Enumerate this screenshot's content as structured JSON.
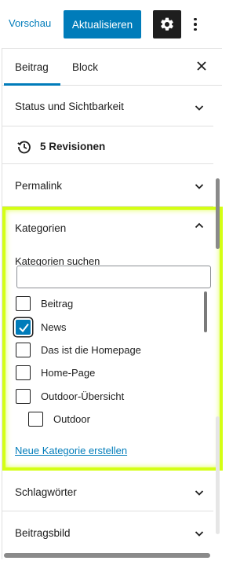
{
  "toolbar": {
    "preview_label": "Vorschau",
    "update_label": "Aktualisieren",
    "settings_icon": "gear-icon",
    "more_icon": "more-vertical-icon"
  },
  "tabs": {
    "post": "Beitrag",
    "block": "Block"
  },
  "panels": {
    "status": "Status und Sichtbarkeit",
    "revisions": "5 Revisionen",
    "permalink": "Permalink",
    "categories": "Kategorien",
    "tags": "Schlagwörter",
    "featured_image": "Beitragsbild"
  },
  "categories": {
    "search_label": "Kategorien suchen",
    "search_value": "",
    "items": [
      {
        "label": "Beitrag",
        "checked": false
      },
      {
        "label": "News",
        "checked": true
      },
      {
        "label": "Das ist die Homepage",
        "checked": false
      },
      {
        "label": "Home-Page",
        "checked": false
      },
      {
        "label": "Outdoor-Übersicht",
        "checked": false
      },
      {
        "label": "Outdoor",
        "checked": false
      }
    ],
    "add_new_label": "Neue Kategorie erstellen"
  },
  "colors": {
    "accent": "#007cba",
    "highlight": "#d4ff14"
  }
}
